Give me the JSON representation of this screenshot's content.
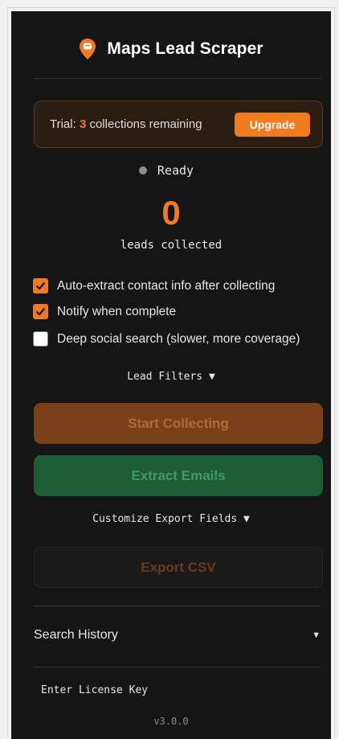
{
  "app": {
    "title": "Maps Lead Scraper",
    "icon": "map-pin-icon",
    "accent_color": "#f07a1c"
  },
  "trial": {
    "prefix": "Trial: ",
    "count": "3",
    "suffix": " collections remaining",
    "upgrade_label": "Upgrade"
  },
  "status": {
    "text": "Ready",
    "dot_color": "#9a8a94"
  },
  "leads": {
    "count": "0",
    "caption": "leads collected"
  },
  "options": [
    {
      "label": "Auto-extract contact info after collecting",
      "checked": true
    },
    {
      "label": "Notify when complete",
      "checked": true
    },
    {
      "label": "Deep social search (slower, more coverage)",
      "checked": false
    }
  ],
  "filters": {
    "label": "Lead Filters ▼"
  },
  "actions": {
    "start_label": "Start Collecting",
    "extract_label": "Extract Emails",
    "customize_label": "Customize Export Fields ▼",
    "export_label": "Export CSV"
  },
  "history": {
    "label": "Search History",
    "arrow": "▼"
  },
  "footer": {
    "license_label": "Enter License Key",
    "version": "v3.0.0"
  }
}
